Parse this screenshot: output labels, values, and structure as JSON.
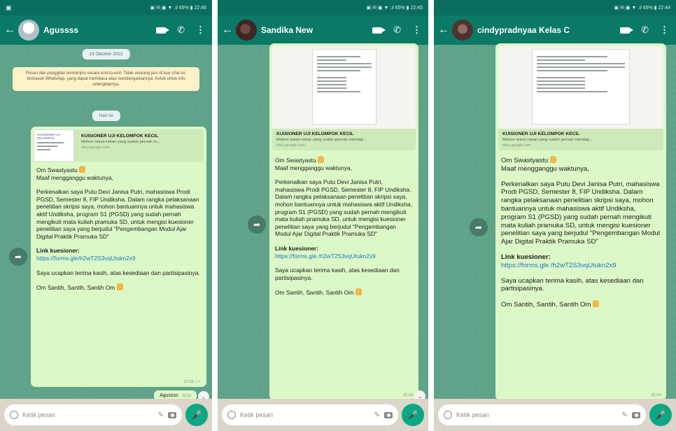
{
  "phones": [
    {
      "status": {
        "left": "▣",
        "right": "▣ ✉ ▣ ▼ .ıl 65% ▮ 22:46"
      },
      "contact": "Agussss",
      "date": "19 Oktober 2022",
      "encryption": "Pesan dan panggilan terenkripsi secara end-to-end. Tidak seorang pun di luar chat ini, termasuk WhatsApp, yang dapat membaca atau mendengarkannya. Ketuk untuk info selengkapnya.",
      "today": "Hari ini",
      "card": {
        "title": "KUISIONER UJI KELOMPOK KECIL",
        "desc": "Mohon rekan-rekan yang sudah pernah m...",
        "domain": "docs.google.com",
        "thumb_text": "KUISIONER UJI KELOMPOK"
      },
      "message": {
        "greeting": "Om Swastyastu",
        "p1": "Maaf mengganggu waktunya,",
        "p2": "Perkenalkan saya Putu Devi Janisa Putri, mahasiswa Prodi PGSD, Semester 8, FIP Undiksha. Dalam rangka pelaksanaan penelitian skripsi saya, mohon bantuannya untuk mahasiswa aktif Undiksha, program S1 (PGSD) yang sudah pernah mengikuti mata kuliah pramuka SD, untuk mengisi kuesioner penelitian saya yang berjudul \"Pengembangan Modul Ajar Digital Praktik Pramuka SD\"",
        "link_label": "Link kuesioner:",
        "link": "https://forms.gle/h2wT2S3vqUtukn2x9",
        "p3": "Saya ucapkan terima kasih, atas kesediaan dan partisipasinya.",
        "closing": "Om Santih, Santih, Santih Om",
        "time": "22:15 ✓✓"
      },
      "reply": {
        "text": "Agussss",
        "time": "22:15"
      },
      "placeholder": "Ketik pesan"
    },
    {
      "status": {
        "left": "",
        "right": "▣ ✉ ▣ ▼ .ıl 65% ▮ 22:45"
      },
      "contact": "Sandika New",
      "card": {
        "title": "KUISIONER UJI KELOMPOK KECIL",
        "desc": "Mohon rekan-rekan yang sudah pernah mendap...",
        "domain": "docs.google.com"
      },
      "message": {
        "greeting": "Om Swastyastu",
        "p1": "Maaf mengganggu waktunya,",
        "p2": "Perkenalkan saya Putu Devi Janisa Putri, mahasiswa Prodi PGSD, Semester 8, FIP Undiksha. Dalam rangka pelaksanaan penelitian skripsi saya, mohon bantuannya untuk mahasiswa aktif Undiksha, program S1 (PGSD) yang sudah pernah mengikuti mata kuliah pramuka SD, untuk mengisi kuesioner penelitian saya yang berjudul \"Pengembangan Modul Ajar Digital Praktik Pramuka SD\"",
        "link_label": "Link kuesioner:",
        "link": "https://forms.gle /h2wT2S3vqUtukn2x9",
        "p3": "Saya ucapkan terima kasih, atas kesediaan dan partisipasinya.",
        "closing": "Om Santih, Santih, Santih Om",
        "time": "22:33"
      },
      "placeholder": "Ketik pesan"
    },
    {
      "status": {
        "left": "",
        "right": "▣ ✉ ▣ ▼ .ıl 65% ▮ 22:44"
      },
      "contact": "cindypradnyaa Kelas C",
      "card": {
        "title": "KUISIONER UJI KELOMPOK KECIL",
        "desc": "Mohon rekan-rekan yang sudah pernah mendap...",
        "domain": "docs.google.com"
      },
      "message": {
        "greeting": "Om Swastyastu",
        "p1": "Maaf mengganggu waktunya,",
        "p2": "Perkenalkan saya Putu Devi Janisa Putri, mahasiswa Prodi PGSD, Semester 8, FIP Undiksha. Dalam rangka pelaksanaan penelitian skripsi saya, mohon bantuannya untuk mahasiswa aktif Undiksha, program S1 (PGSD) yang sudah pernah mengikuti mata kuliah pramuka SD, untuk mengisi kuesioner penelitian saya yang berjudul \"Pengembangan Modul Ajar Digital Praktik Pramuka SD\"",
        "link_label": "Link kuesioner:",
        "link": "https://forms.gle /h2wT2S3vqUtukn2x9",
        "p3": "Saya ucapkan terima kasih, atas kesediaan dan partisipasinya.",
        "closing": "Om Santih, Santih, Santih Om",
        "time": "22:14"
      },
      "placeholder": "Ketik pesan"
    }
  ],
  "icons": {
    "back": "←",
    "call": "✆",
    "more": "⋮",
    "forward": "➦",
    "clip": "✎",
    "mic": "🎤",
    "scroll": "⌄"
  },
  "colors": {
    "header": "#0a7a67",
    "bubble": "#dcf8c6",
    "chat_bg": "#5fa38b",
    "mic": "#0aa884",
    "link": "#1a73c8"
  }
}
